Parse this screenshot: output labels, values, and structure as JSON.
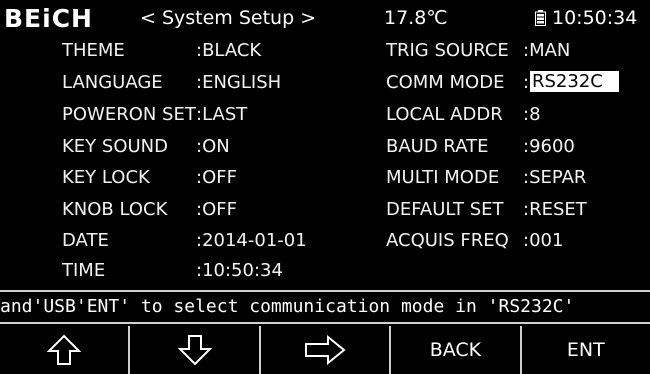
{
  "header": {
    "brand": "BEiCH",
    "title": "< System Setup >",
    "temperature": "17.8℃",
    "time": "10:50:34"
  },
  "settings_left": [
    {
      "label": "THEME",
      "value": ":BLACK"
    },
    {
      "label": "LANGUAGE",
      "value": ":ENGLISH"
    },
    {
      "label": "POWERON SET",
      "value": ":LAST"
    },
    {
      "label": "KEY SOUND",
      "value": ":ON"
    },
    {
      "label": "KEY LOCK",
      "value": ":OFF"
    },
    {
      "label": "KNOB LOCK",
      "value": ":OFF"
    },
    {
      "label": "DATE",
      "value": ":2014-01-01"
    },
    {
      "label": "TIME",
      "value": ":10:50:34"
    }
  ],
  "settings_right": [
    {
      "label": "TRIG SOURCE",
      "value": ":MAN"
    },
    {
      "label": "COMM MODE",
      "value": ":",
      "selected_value": "RS232C"
    },
    {
      "label": "LOCAL ADDR",
      "value": ":8"
    },
    {
      "label": "BAUD RATE",
      "value": ":9600"
    },
    {
      "label": "MULTI MODE",
      "value": ":SEPAR"
    },
    {
      "label": "DEFAULT SET",
      "value": ":RESET"
    },
    {
      "label": "ACQUIS FREQ",
      "value": ":001"
    }
  ],
  "help": {
    "text": "and'USB'ENT' to select communication mode in 'RS232C'"
  },
  "softkeys": {
    "up_icon": "arrow-up-icon",
    "down_icon": "arrow-down-icon",
    "right_icon": "arrow-right-icon",
    "back_label": "BACK",
    "ent_label": "ENT"
  },
  "colors": {
    "background": "#000000",
    "text": "#f2f2f2",
    "selection": "#ffffff"
  }
}
